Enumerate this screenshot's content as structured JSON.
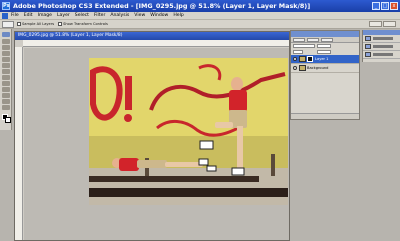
{
  "window": {
    "title": "Adobe Photoshop CS3 Extended - [IMG_0295.jpg @ 51.8% (Layer 1, Layer Mask/8)]"
  },
  "menus": [
    "File",
    "Edit",
    "Image",
    "Layer",
    "Select",
    "Filter",
    "Analysis",
    "View",
    "Window",
    "Help"
  ],
  "options_bar": {
    "sample_label": "Sample All Layers",
    "contiguous_label": "Show Transform Controls"
  },
  "document": {
    "tab_title": "IMG_0295.jpg @ 51.8% (Layer 1, Layer Mask/8)",
    "zoom": "51.8%"
  },
  "layers_panel": {
    "blend_mode": "Normal",
    "layers": [
      {
        "name": "Layer 1",
        "active": true
      },
      {
        "name": "Background",
        "active": false
      }
    ]
  },
  "colors": {
    "accent": "#3264c8",
    "title_bar": "#2449a9",
    "workspace": "#b7b4ae"
  }
}
